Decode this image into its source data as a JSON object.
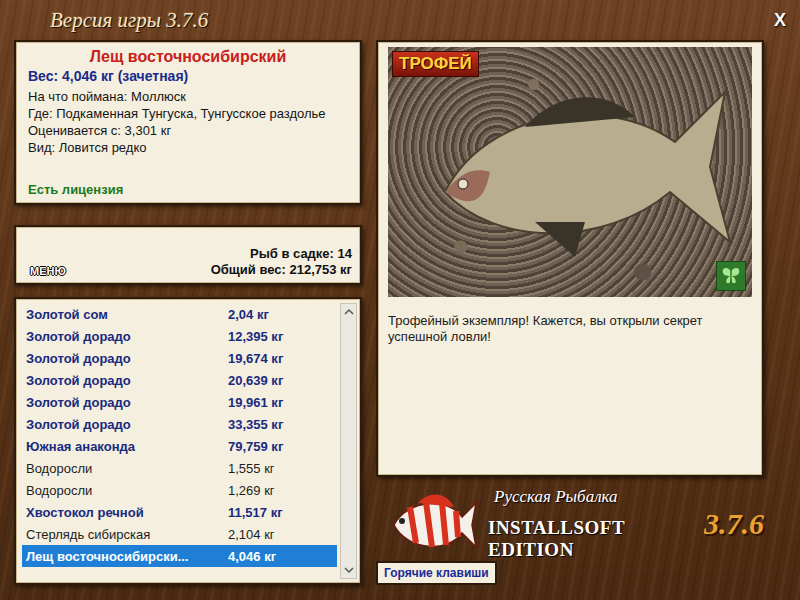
{
  "window": {
    "title": "Версия игры 3.7.6",
    "close": "X"
  },
  "fish_info": {
    "name": "Лещ восточносибирский",
    "weight": "Вес: 4,046 кг (зачетная)",
    "details": [
      "На что поймана: Моллюск",
      "Где: Подкаменная Тунгуска, Тунгусское раздолье",
      "Оценивается с: 3,301 кг",
      "Вид: Ловится редко"
    ],
    "license": "Есть лицензия"
  },
  "summary": {
    "menu_button": "МЕНЮ",
    "count": "Рыб в садке: 14",
    "total": "Общий вес: 212,753 кг"
  },
  "catch_list": {
    "rows": [
      {
        "name": "Золотой сом",
        "weight": "2,04 кг",
        "kind": "fish",
        "selected": false
      },
      {
        "name": "Золотой дорадо",
        "weight": "12,395 кг",
        "kind": "fish",
        "selected": false
      },
      {
        "name": "Золотой дорадо",
        "weight": "19,674 кг",
        "kind": "fish",
        "selected": false
      },
      {
        "name": "Золотой дорадо",
        "weight": "20,639 кг",
        "kind": "fish",
        "selected": false
      },
      {
        "name": "Золотой дорадо",
        "weight": "19,961 кг",
        "kind": "fish",
        "selected": false
      },
      {
        "name": "Золотой дорадо",
        "weight": "33,355 кг",
        "kind": "fish",
        "selected": false
      },
      {
        "name": "Южная анаконда",
        "weight": "79,759 кг",
        "kind": "fish",
        "selected": false
      },
      {
        "name": "Водоросли",
        "weight": "1,555 кг",
        "kind": "trash",
        "selected": false
      },
      {
        "name": "Водоросли",
        "weight": "1,269 кг",
        "kind": "trash",
        "selected": false
      },
      {
        "name": "Хвостокол речной",
        "weight": "11,517 кг",
        "kind": "fish",
        "selected": false
      },
      {
        "name": "Стерлядь сибирская",
        "weight": "2,104 кг",
        "kind": "trash",
        "selected": false
      },
      {
        "name": "Лещ восточносибирски...",
        "weight": "4,046 кг",
        "kind": "fish",
        "selected": true
      }
    ]
  },
  "photo": {
    "badge": "ТРОФЕЙ"
  },
  "message": "Трофейный экземпляр! Кажется, вы открыли секрет успешной ловли!",
  "logo": {
    "title": "Русская Рыбалка",
    "edition": "INSTALLSOFT EDITION",
    "version": "3.7.6"
  },
  "hotkeys_button": "Горячие клавиши"
}
